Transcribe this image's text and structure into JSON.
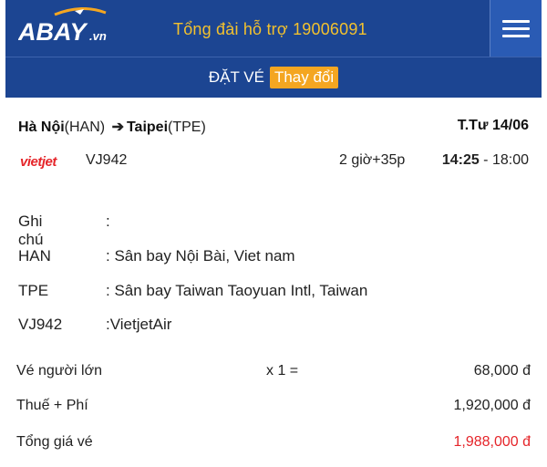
{
  "header": {
    "logo_text": "ABAY.vn",
    "hotline": "Tổng đài hỗ trợ 19006091",
    "menu_icon": "hamburger-icon",
    "accent_color": "#1c4592",
    "hotline_color": "#f2c12e"
  },
  "subheader": {
    "title": "ĐẶT VÉ",
    "change_label": "Thay đổi",
    "change_color": "#f4a621"
  },
  "flight": {
    "from_city": "Hà Nội",
    "from_code": "(HAN)",
    "arrow": "➔",
    "to_city": "Taipei",
    "to_code": "(TPE)",
    "date": "T.Tư 14/06",
    "airline_logo_text": "vietjet",
    "flight_no": "VJ942",
    "duration": "2 giờ+35p",
    "depart": "14:25",
    "separator": " - ",
    "arrive": "18:00"
  },
  "details": {
    "note_key": "Ghi chú",
    "note_val": ":",
    "han_key": "HAN",
    "han_val": ": Sân bay Nội Bài, Viet nam",
    "tpe_key": "TPE",
    "tpe_val": ": Sân bay Taiwan Taoyuan Intl, Taiwan",
    "flight_key": "VJ942",
    "flight_val": ":VietjetAir"
  },
  "pricing": {
    "adult_label": "Vé người lớn",
    "adult_qty": "x 1 =",
    "adult_price": "68,000 đ",
    "tax_label": "Thuế + Phí",
    "tax_price": "1,920,000 đ",
    "total_label": "Tổng giá vé",
    "total_price": "1,988,000 đ",
    "total_color": "#e5252a"
  }
}
